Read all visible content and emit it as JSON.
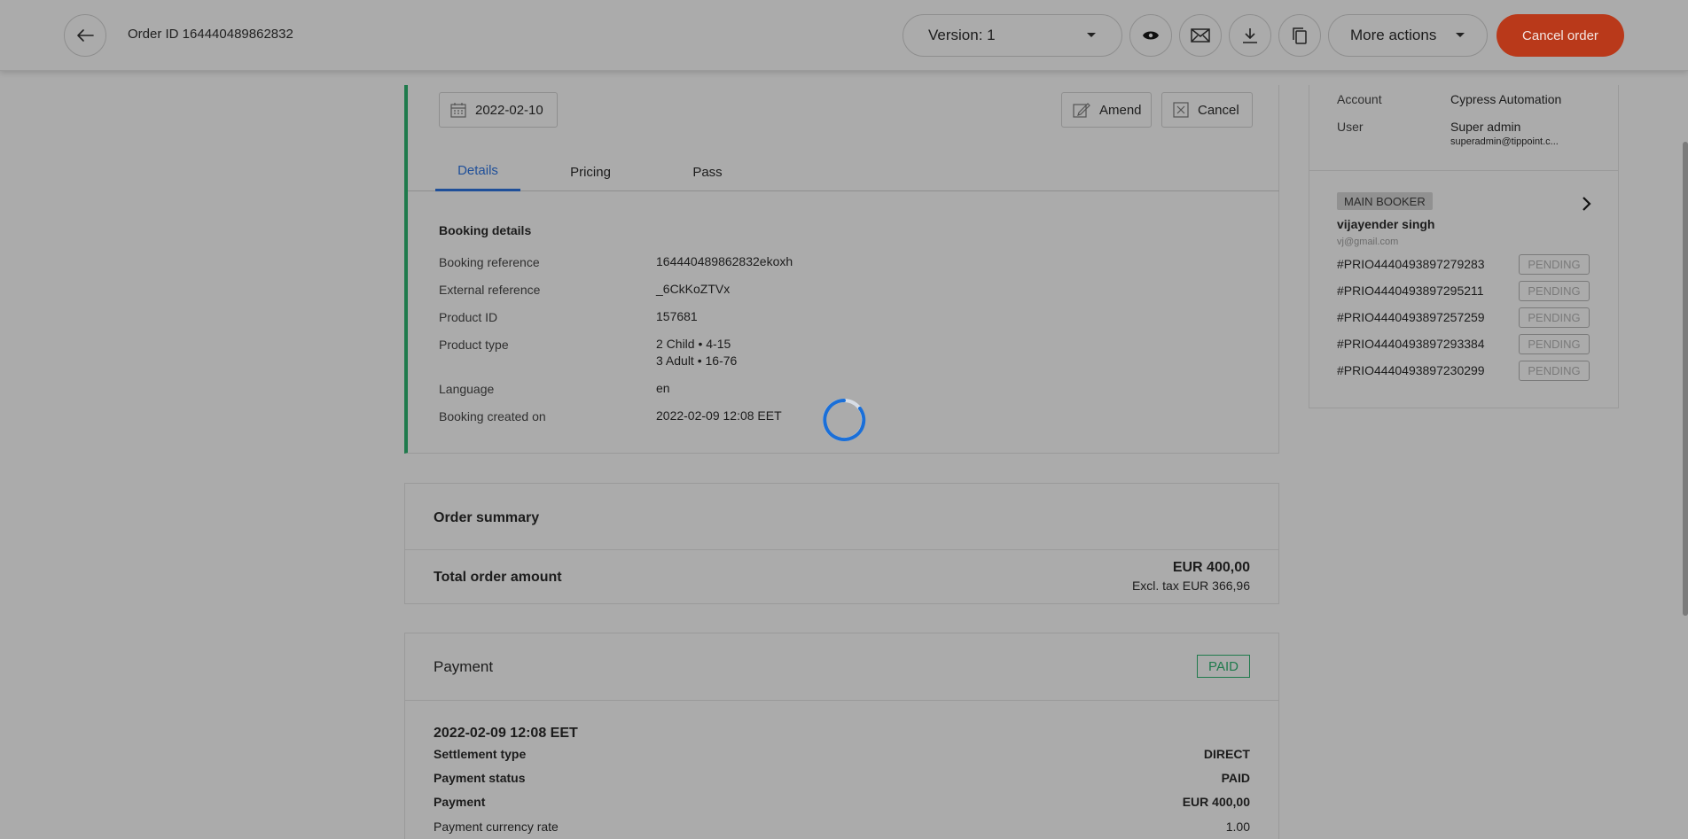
{
  "header": {
    "order_id_label": "Order ID 164440489862832",
    "version_label": "Version: 1",
    "more_actions_label": "More actions",
    "cancel_order_label": "Cancel order"
  },
  "booking": {
    "date": "2022-02-10",
    "amend_label": "Amend",
    "cancel_label": "Cancel",
    "tabs": [
      {
        "label": "Details",
        "active": true
      },
      {
        "label": "Pricing",
        "active": false
      },
      {
        "label": "Pass",
        "active": false
      }
    ],
    "section_title": "Booking details",
    "fields": {
      "booking_reference": {
        "label": "Booking reference",
        "value": "164440489862832ekoxh"
      },
      "external_reference": {
        "label": "External reference",
        "value": "_6CkKoZTVx"
      },
      "product_id": {
        "label": "Product ID",
        "value": "157681"
      },
      "product_type": {
        "label": "Product type",
        "value_line1": "2 Child • 4-15",
        "value_line2": "3 Adult • 16-76"
      },
      "language": {
        "label": "Language",
        "value": "en"
      },
      "booking_created_on": {
        "label": "Booking created on",
        "value": "2022-02-09 12:08 EET"
      }
    }
  },
  "order_summary": {
    "title": "Order summary",
    "total_label": "Total order amount",
    "total_amount": "EUR 400,00",
    "excl_tax": "Excl. tax EUR 366,96"
  },
  "payment": {
    "title": "Payment",
    "status_badge": "PAID",
    "date": "2022-02-09 12:08 EET",
    "rows": [
      {
        "label": "Settlement type",
        "value": "DIRECT"
      },
      {
        "label": "Payment status",
        "value": "PAID"
      },
      {
        "label": "Payment",
        "value": "EUR 400,00"
      },
      {
        "label": "Payment currency rate",
        "value": "1.00"
      }
    ]
  },
  "side_panel": {
    "account_label": "Account",
    "account_value": "Cypress Automation",
    "user_label": "User",
    "user_value": "Super admin",
    "user_email": "superadmin@tippoint.c...",
    "main_booker_badge": "MAIN BOOKER",
    "booker_name": "vijayender singh",
    "booker_email": "vj@gmail.com",
    "tickets": [
      {
        "id": "#PRIO4440493897279283",
        "status": "PENDING"
      },
      {
        "id": "#PRIO4440493897295211",
        "status": "PENDING"
      },
      {
        "id": "#PRIO4440493897257259",
        "status": "PENDING"
      },
      {
        "id": "#PRIO4440493897293384",
        "status": "PENDING"
      },
      {
        "id": "#PRIO4440493897230299",
        "status": "PENDING"
      }
    ]
  },
  "colors": {
    "accent_blue": "#1f4f99",
    "cancel_red": "#b9391a",
    "paid_green": "#1f7a4c",
    "overlay_gray": "#ababab"
  },
  "icons": [
    "back-arrow-icon",
    "chevron-down-icon",
    "eye-icon",
    "mail-icon",
    "download-icon",
    "copy-icon",
    "calendar-icon",
    "edit-icon",
    "close-box-icon",
    "chevron-right-icon",
    "loading-spinner-icon"
  ]
}
